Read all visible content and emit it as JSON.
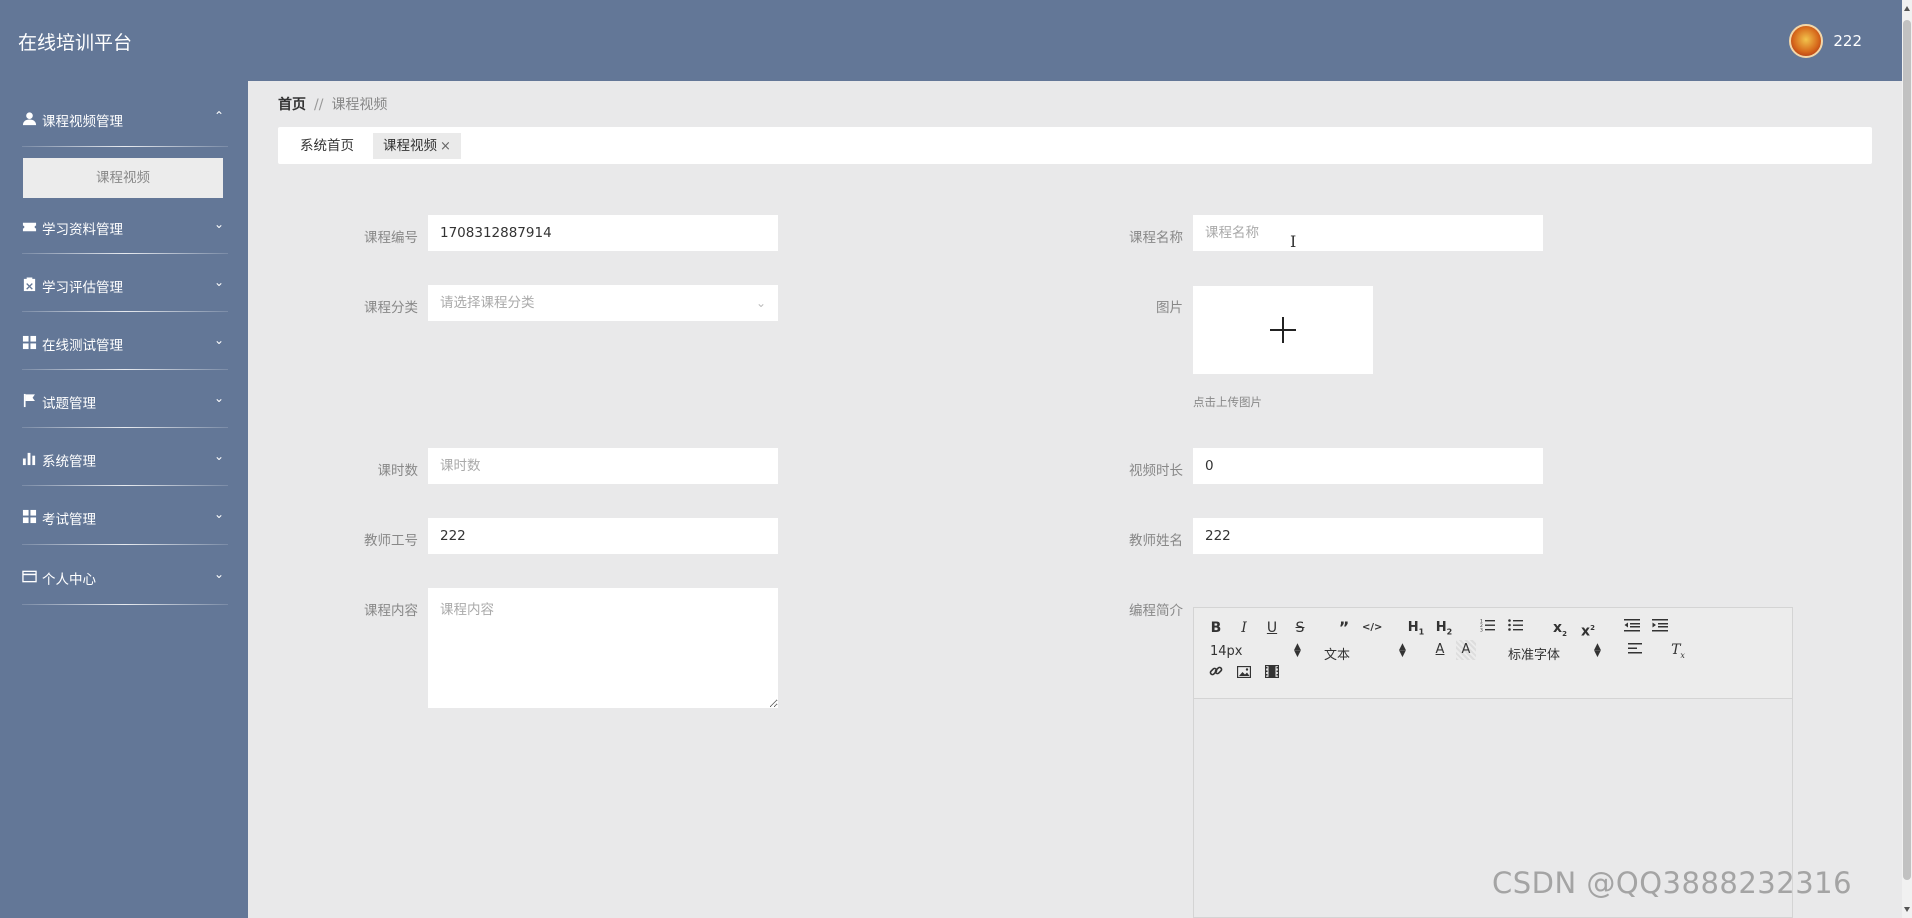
{
  "app": {
    "title": "在线培训平台"
  },
  "user": {
    "name": "222"
  },
  "sidebar": {
    "items": [
      {
        "label": "课程视频管理",
        "icon": "user-icon",
        "expanded": true,
        "sub": [
          "课程视频"
        ]
      },
      {
        "label": "学习资料管理",
        "icon": "ticket-icon"
      },
      {
        "label": "学习评估管理",
        "icon": "clipboard-icon"
      },
      {
        "label": "在线测试管理",
        "icon": "grid-icon"
      },
      {
        "label": "试题管理",
        "icon": "flag-icon"
      },
      {
        "label": "系统管理",
        "icon": "bar-chart-icon"
      },
      {
        "label": "考试管理",
        "icon": "grid-icon"
      },
      {
        "label": "个人中心",
        "icon": "card-icon"
      }
    ]
  },
  "breadcrumb": {
    "home": "首页",
    "separator": "//",
    "current": "课程视频"
  },
  "tabs": [
    {
      "label": "系统首页"
    },
    {
      "label": "课程视频",
      "close": "×"
    }
  ],
  "form": {
    "course_no": {
      "label": "课程编号",
      "value": "1708312887914"
    },
    "course_name": {
      "label": "课程名称",
      "placeholder": "课程名称",
      "value": ""
    },
    "category": {
      "label": "课程分类",
      "placeholder": "请选择课程分类"
    },
    "image": {
      "label": "图片",
      "hint": "点击上传图片"
    },
    "lessons": {
      "label": "课时数",
      "placeholder": "课时数",
      "value": ""
    },
    "video_length": {
      "label": "视频时长",
      "value": "0"
    },
    "teacher_id": {
      "label": "教师工号",
      "value": "222"
    },
    "teacher_name": {
      "label": "教师姓名",
      "value": "222"
    },
    "content": {
      "label": "课程内容",
      "placeholder": "课程内容"
    },
    "intro": {
      "label": "编程简介"
    }
  },
  "editor": {
    "font_size": "14px",
    "block_format": "文本",
    "font_family": "标准字体"
  },
  "watermark": "CSDN @QQ3888232316",
  "colors": {
    "header": "#637797",
    "sidebar": "#637797",
    "background": "#e9e9ea"
  }
}
